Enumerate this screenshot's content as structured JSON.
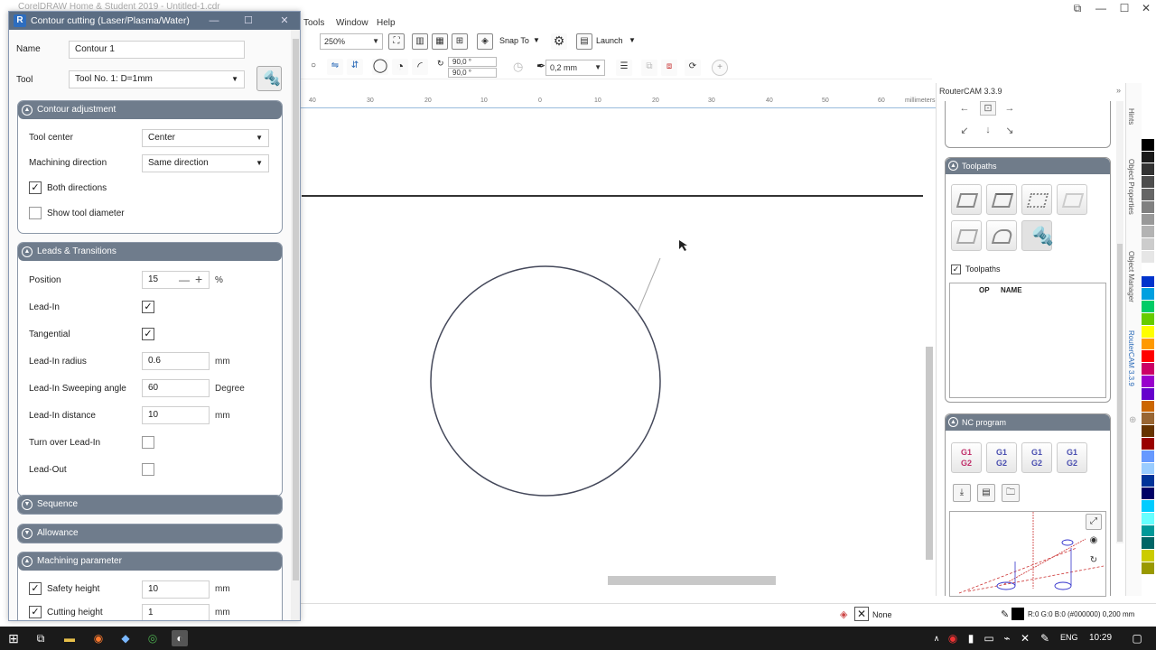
{
  "app": {
    "title": "CorelDRAW Home & Student 2019 - Untitled-1.cdr",
    "menu": [
      "Tools",
      "Window",
      "Help"
    ],
    "zoom": "250%",
    "snap_to": "Snap To",
    "launch": "Launch",
    "angle1": "90,0 °",
    "angle2": "90,0 °",
    "outline_width": "0,2 mm",
    "ruler_labels": [
      "40",
      "30",
      "20",
      "10",
      "0",
      "10",
      "20",
      "30",
      "40",
      "50",
      "60",
      "millimeters"
    ]
  },
  "dialog": {
    "title": "Contour cutting (Laser/Plasma/Water)",
    "name_label": "Name",
    "name_value": "Contour 1",
    "tool_label": "Tool",
    "tool_value": "Tool No. 1: D=1mm",
    "contour_adjustment": {
      "header": "Contour adjustment",
      "tool_center_label": "Tool center",
      "tool_center_value": "Center",
      "machining_direction_label": "Machining direction",
      "machining_direction_value": "Same direction",
      "both_directions_label": "Both directions",
      "both_directions_checked": true,
      "show_tool_diameter_label": "Show tool diameter",
      "show_tool_diameter_checked": false
    },
    "leads": {
      "header": "Leads & Transitions",
      "position_label": "Position",
      "position_value": "15",
      "position_unit": "%",
      "lead_in_label": "Lead-In",
      "lead_in_checked": true,
      "tangential_label": "Tangential",
      "tangential_checked": true,
      "lead_in_radius_label": "Lead-In radius",
      "lead_in_radius_value": "0.6",
      "lead_in_radius_unit": "mm",
      "sweep_label": "Lead-In Sweeping angle",
      "sweep_value": "60",
      "sweep_unit": "Degree",
      "distance_label": "Lead-In distance",
      "distance_value": "10",
      "distance_unit": "mm",
      "turn_over_label": "Turn over Lead-In",
      "turn_over_checked": false,
      "lead_out_label": "Lead-Out",
      "lead_out_checked": false
    },
    "sequence_header": "Sequence",
    "allowance_header": "Allowance",
    "machining": {
      "header": "Machining parameter",
      "safety_height_label": "Safety height",
      "safety_height_value": "10",
      "safety_height_unit": "mm",
      "cutting_height_label": "Cutting height",
      "cutting_height_value": "1",
      "cutting_height_unit": "mm"
    }
  },
  "docker": {
    "title": "RouterCAM 3.3.9",
    "toolpaths_header": "Toolpaths",
    "toolpaths_check_label": "Toolpaths",
    "col_op": "OP",
    "col_name": "NAME",
    "nc_header": "NC program",
    "nc_btn_label": "G1\nG2",
    "vtabs": [
      "Hints",
      "Object Properties",
      "Object Manager",
      "RouterCAM 3.3.9"
    ]
  },
  "status": {
    "fill": "None",
    "outline": "R:0 G:0 B:0 (#000000)  0,200 mm"
  },
  "taskbar": {
    "lang": "ENG",
    "time": "10:29"
  },
  "palette": [
    "#ffffff",
    "#000000",
    "#1a1a1a",
    "#333333",
    "#4d4d4d",
    "#666666",
    "#808080",
    "#999999",
    "#b3b3b3",
    "#cccccc",
    "#e6e6e6",
    "#ffffff",
    "#0033cc",
    "#00a0e0",
    "#00cc66",
    "#66cc00",
    "#ffff00",
    "#ff9900",
    "#ff0000",
    "#cc0066",
    "#9900cc",
    "#6600cc",
    "#cc6600",
    "#996633",
    "#663300",
    "#990000",
    "#6699ff",
    "#99ccff",
    "#003399",
    "#000066",
    "#00ccff",
    "#66ffff",
    "#009999",
    "#006666",
    "#cccc00",
    "#999900"
  ]
}
